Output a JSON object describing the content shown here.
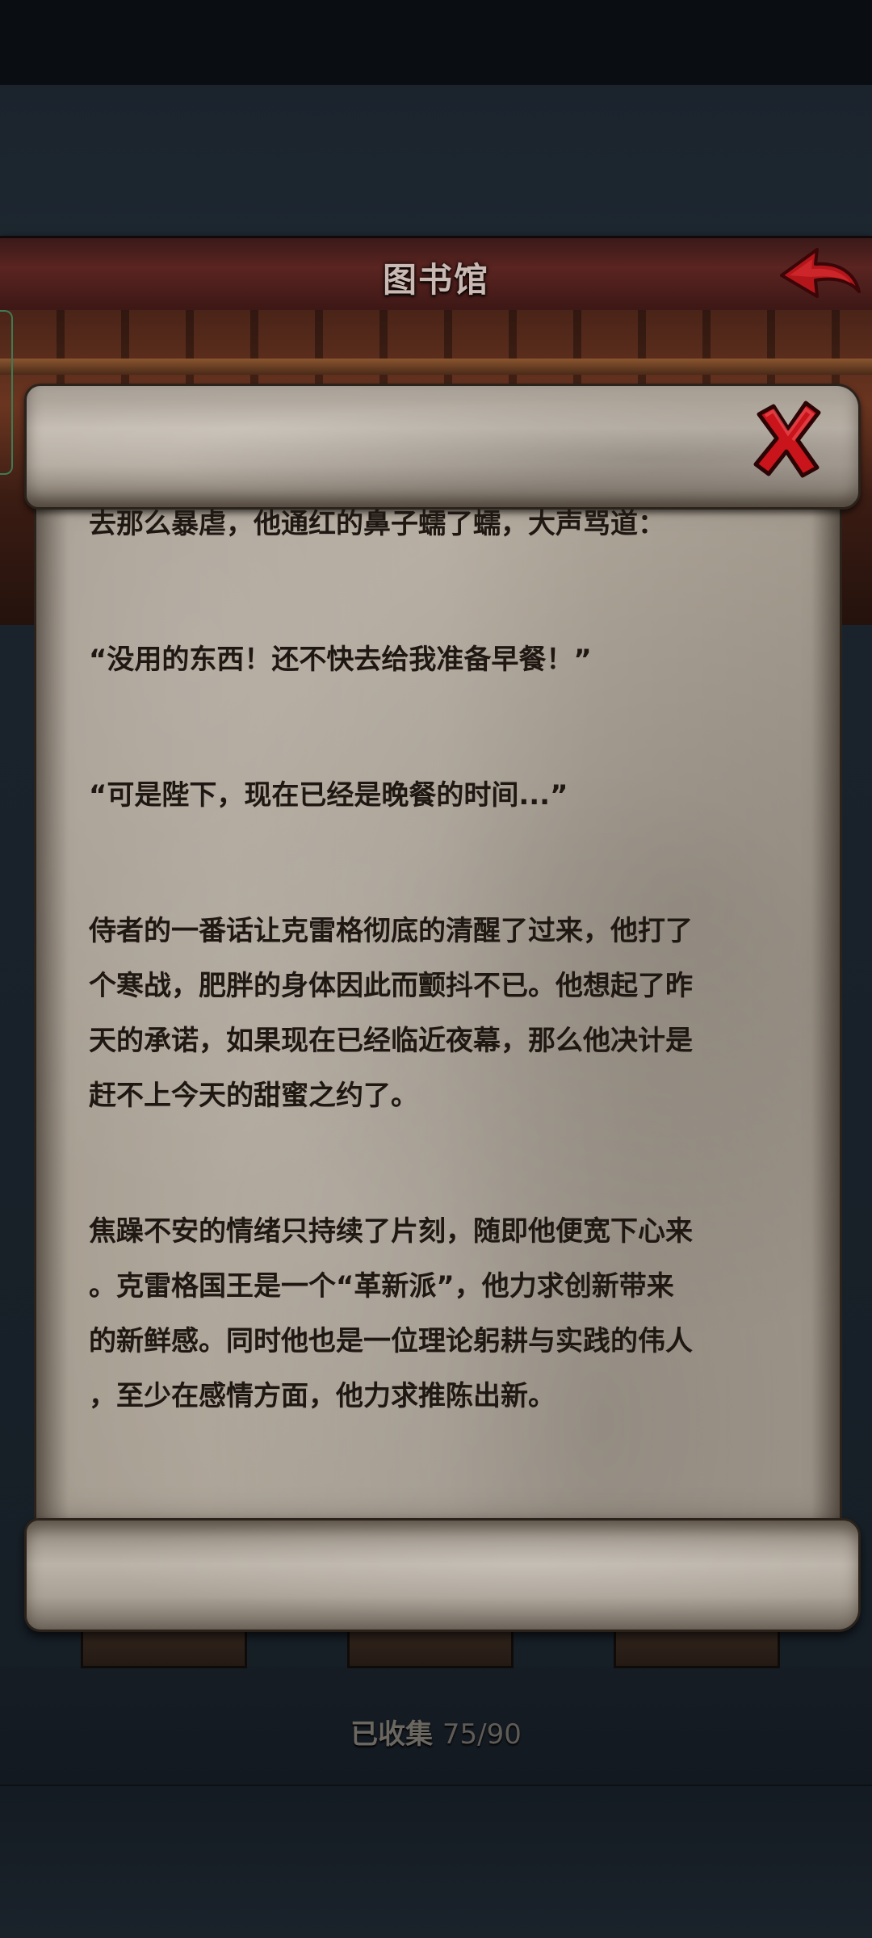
{
  "header": {
    "title": "图书馆"
  },
  "scroll": {
    "paragraphs": [
      [
        "去那么暴虐，他通红的鼻子蠕了蠕，大声骂道："
      ],
      [
        "“没用的东西！还不快去给我准备早餐！”"
      ],
      [
        "“可是陛下，现在已经是晚餐的时间...”"
      ],
      [
        "侍者的一番话让克雷格彻底的清醒了过来，他打了",
        "个寒战，肥胖的身体因此而颤抖不已。他想起了昨",
        "天的承诺，如果现在已经临近夜幕，那么他决计是",
        "赶不上今天的甜蜜之约了。"
      ],
      [
        "焦躁不安的情绪只持续了片刻，随即他便宽下心来",
        "。克雷格国王是一个“革新派”，他力求创新带来",
        "的新鲜感。同时他也是一位理论躬耕与实践的伟人",
        "，至少在感情方面，他力求推陈出新。"
      ]
    ]
  },
  "footer": {
    "collected_label": "已收集",
    "collected_count": "75/90"
  },
  "icons": {
    "back": "red-back-arrow-icon",
    "close": "red-x-close-icon"
  },
  "colors": {
    "title_bar": "#5a2421",
    "close_x": "#c8141a",
    "back_arrow": "#b3161a",
    "parchment": "#b4ab9f"
  }
}
